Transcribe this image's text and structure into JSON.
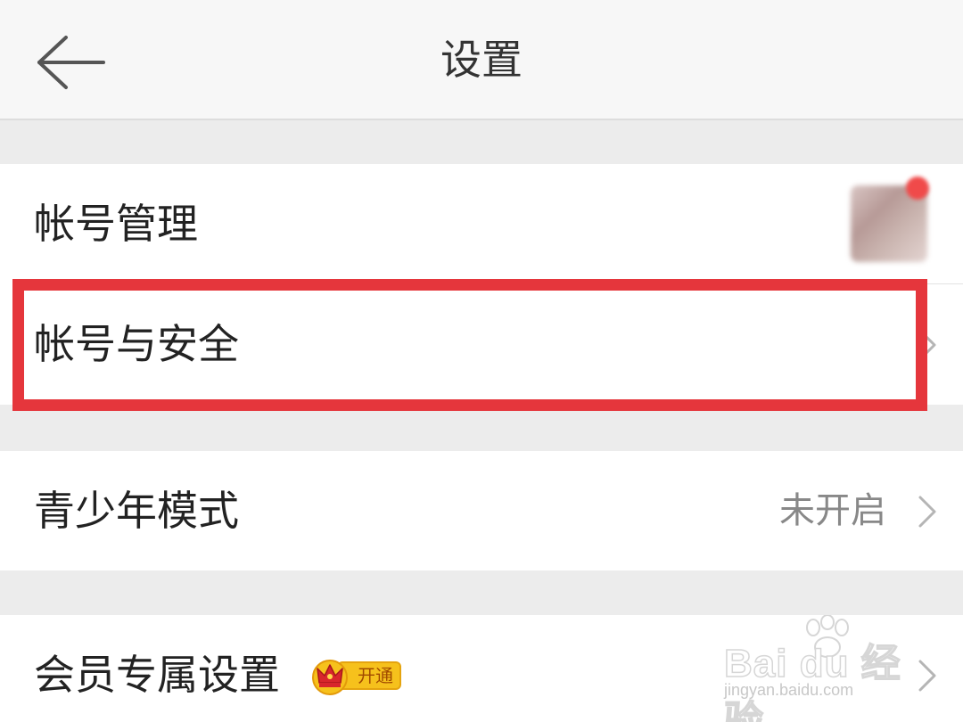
{
  "header": {
    "title": "设置"
  },
  "account_group": {
    "items": [
      {
        "label": "帐号管理"
      },
      {
        "label": "帐号与安全"
      }
    ]
  },
  "teen_group": {
    "label": "青少年模式",
    "status": "未开启"
  },
  "vip_group": {
    "label": "会员专属设置",
    "badge_text": "开通"
  },
  "watermark": {
    "logo": "Bai du 经验",
    "url": "jingyan.baidu.com"
  },
  "colors": {
    "highlight": "#e5363c",
    "badge": "#f6c11c",
    "status_text": "#888888"
  }
}
